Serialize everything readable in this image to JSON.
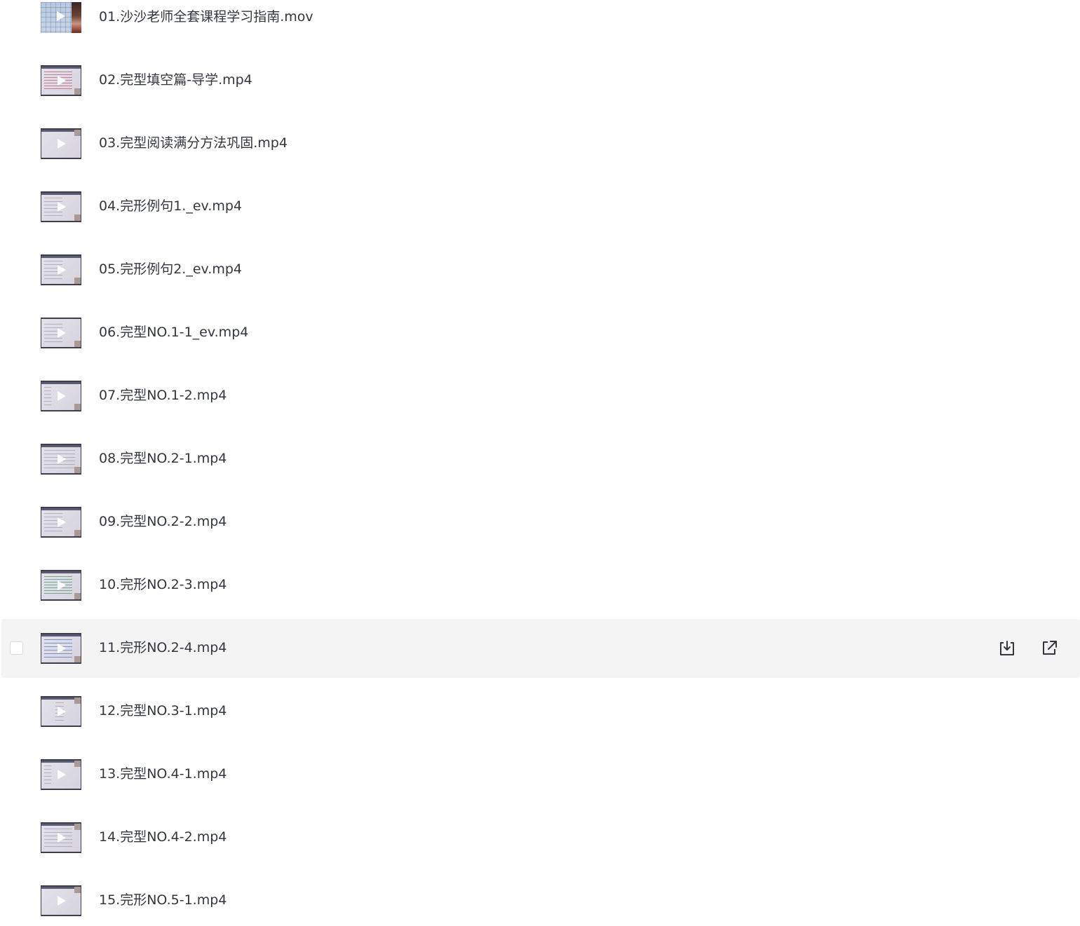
{
  "files": [
    {
      "name": "01.沙沙老师全套课程学习指南.mov"
    },
    {
      "name": "02.完型填空篇-导学.mp4"
    },
    {
      "name": "03.完型阅读满分方法巩固.mp4"
    },
    {
      "name": "04.完形例句1._ev.mp4"
    },
    {
      "name": "05.完形例句2._ev.mp4"
    },
    {
      "name": "06.完型NO.1-1_ev.mp4"
    },
    {
      "name": "07.完型NO.1-2.mp4"
    },
    {
      "name": "08.完型NO.2-1.mp4"
    },
    {
      "name": "09.完型NO.2-2.mp4"
    },
    {
      "name": "10.完形NO.2-3.mp4"
    },
    {
      "name": "11.完形NO.2-4.mp4"
    },
    {
      "name": "12.完型NO.3-1.mp4"
    },
    {
      "name": "13.完型NO.4-1.mp4"
    },
    {
      "name": "14.完型NO.4-2.mp4"
    },
    {
      "name": "15.完形NO.5-1.mp4"
    }
  ],
  "hovered_row_index": 10,
  "row_actions": {
    "download_icon": "download-icon",
    "open_icon": "open-external-icon"
  },
  "colors": {
    "text": "#33363c",
    "hover_bg": "#f4f4f4",
    "icon": "#33363c"
  }
}
